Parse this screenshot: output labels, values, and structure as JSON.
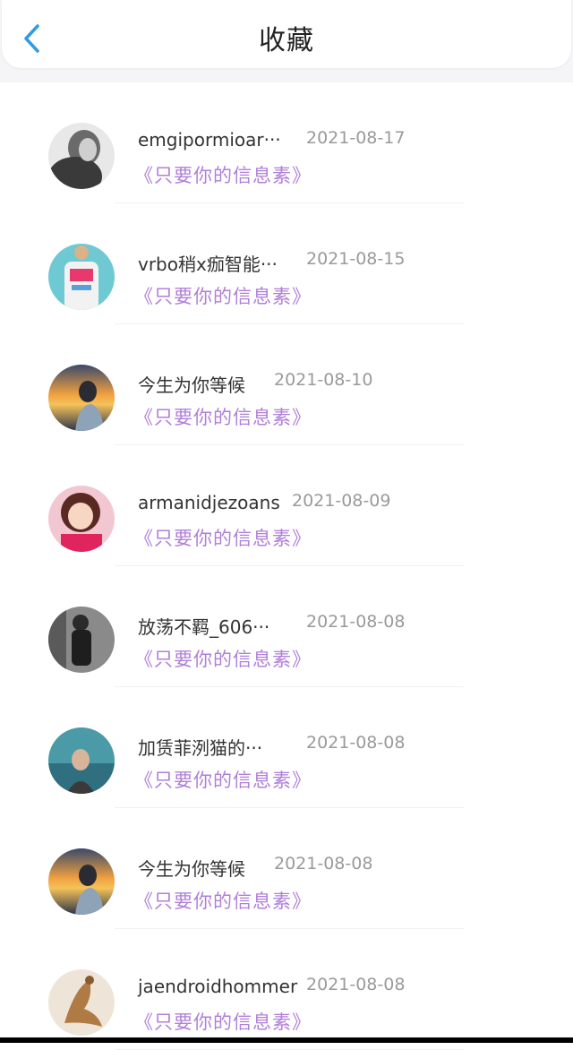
{
  "header": {
    "title": "收藏",
    "back_icon": "chevron-left-icon",
    "accent_color": "#2f9be8"
  },
  "song_color": "#b07fd9",
  "items": [
    {
      "name": "emgipormioar···",
      "date": "2021-08-17",
      "song": "《只要你的信息素》",
      "avatar": "avatar-gray-woman"
    },
    {
      "name": "vrbo稍x痂智能···",
      "date": "2021-08-15",
      "song": "《只要你的信息素》",
      "avatar": "avatar-dj-shirt"
    },
    {
      "name": "今生为你等候",
      "date": "2021-08-10",
      "song": "《只要你的信息素》",
      "avatar": "avatar-sunset-girl"
    },
    {
      "name": "armanidjezoans",
      "date": "2021-08-09",
      "song": "《只要你的信息素》",
      "avatar": "avatar-pink-doll"
    },
    {
      "name": "放荡不羁_606···",
      "date": "2021-08-08",
      "song": "《只要你的信息素》",
      "avatar": "avatar-dark-figure"
    },
    {
      "name": "加赁菲洌猫的···",
      "date": "2021-08-08",
      "song": "《只要你的信息素》",
      "avatar": "avatar-sea-woman"
    },
    {
      "name": "今生为你等候",
      "date": "2021-08-08",
      "song": "《只要你的信息素》",
      "avatar": "avatar-sunset-girl"
    },
    {
      "name": "jaendroidhommer",
      "date": "2021-08-08",
      "song": "《只要你的信息素》",
      "avatar": "avatar-dancer"
    }
  ]
}
